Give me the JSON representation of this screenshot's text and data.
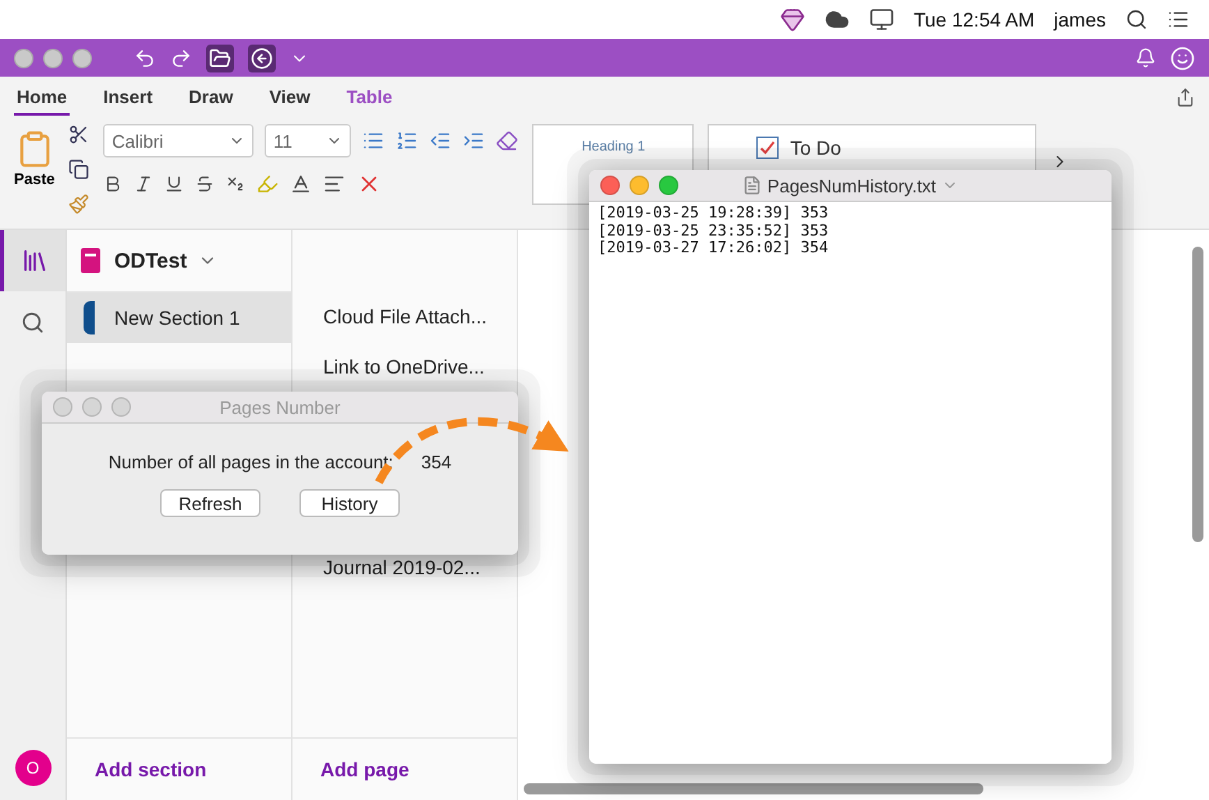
{
  "menubar": {
    "clock": "Tue 12:54 AM",
    "user": "james"
  },
  "ribbon": {
    "tabs": [
      {
        "label": "Home",
        "selected": true,
        "contextual": false
      },
      {
        "label": "Insert",
        "selected": false,
        "contextual": false
      },
      {
        "label": "Draw",
        "selected": false,
        "contextual": false
      },
      {
        "label": "View",
        "selected": false,
        "contextual": false
      },
      {
        "label": "Table",
        "selected": false,
        "contextual": true
      }
    ],
    "paste": "Paste",
    "font": "Calibri",
    "size": "11",
    "style": "Heading 1",
    "tag": {
      "label": "To Do",
      "checked": true
    }
  },
  "notebook": {
    "name": "ODTest",
    "sections": [
      {
        "label": "New Section 1",
        "selected": true,
        "color": "#0f4e8c"
      }
    ],
    "add": "Add section"
  },
  "pages": {
    "items": [
      {
        "label": "Cloud File Attach...",
        "hidden_after": false
      },
      {
        "label": "Link to OneDrive...",
        "hidden_after": true
      },
      {
        "label": "Journal 2019-02...",
        "hidden_after": false
      }
    ],
    "add": "Add page"
  },
  "account": {
    "initial": "O"
  },
  "dialog": {
    "title": "Pages Number",
    "label": "Number of all pages in the account:",
    "count": "354",
    "buttons": [
      "Refresh",
      "History"
    ]
  },
  "editor": {
    "title": "PagesNumHistory.txt",
    "lines": [
      "[2019-03-25 19:28:39] 353",
      "[2019-03-25 23:35:52] 353",
      "[2019-03-27 17:26:02] 354"
    ]
  }
}
